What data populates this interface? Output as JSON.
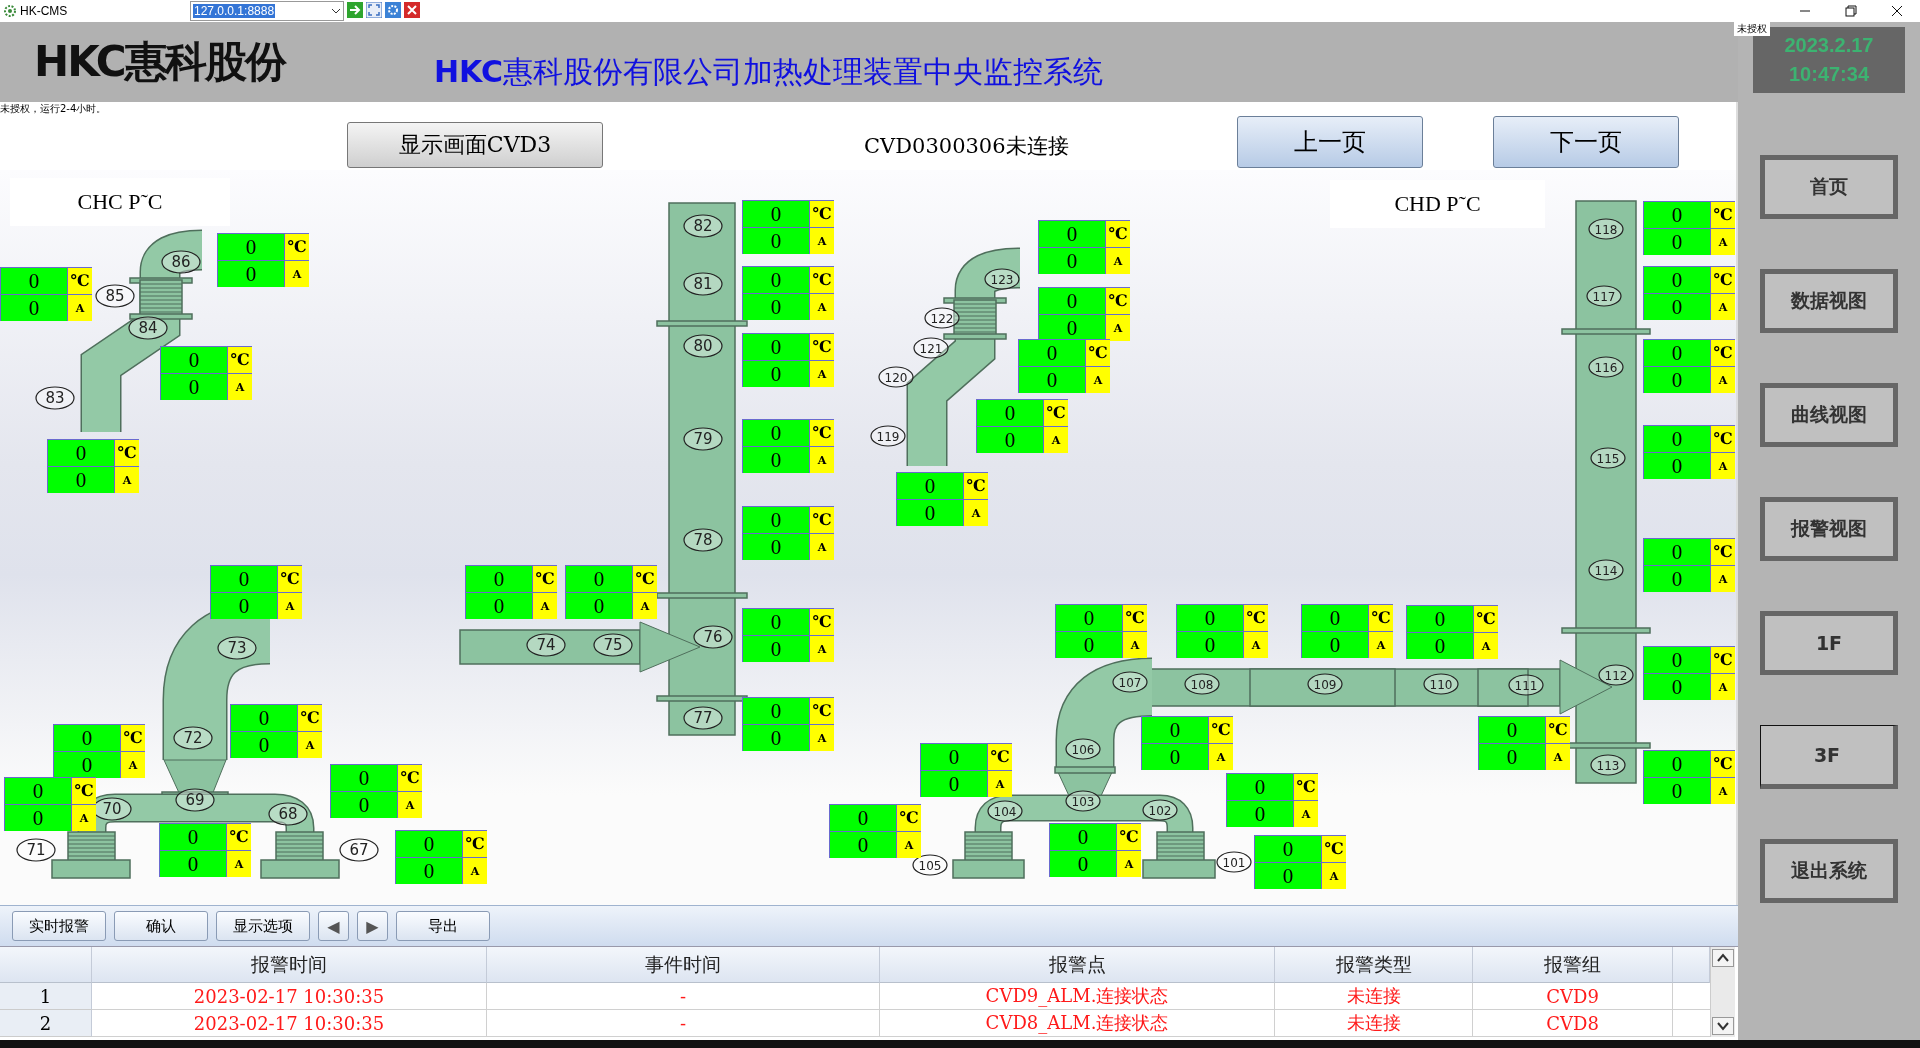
{
  "titlebar": {
    "app_name": "HK-CMS",
    "address": "127.0.0.1:8888"
  },
  "header": {
    "logo": "HKC惠科股份",
    "title": "**HKC**惠科股份有限公司加热处理装置中央监控系统",
    "overlay_notice": "未授权",
    "date": "2023.2.17",
    "time": "10:47:34"
  },
  "license_notice": "未授权，运行2-4小时。",
  "toolbar": {
    "display_button": "显示画面CVD3",
    "status": "CVD0300306未连接",
    "prev_button": "上一页",
    "next_button": "下一页"
  },
  "diagrams": [
    {
      "title": "CHC  P˜C",
      "segments": [
        "86",
        "85",
        "84",
        "83",
        "82",
        "81",
        "80",
        "79",
        "78",
        "73",
        "74",
        "75",
        "76",
        "77",
        "72",
        "70",
        "69",
        "68",
        "71",
        "67"
      ],
      "readings": [
        {
          "temp": "0",
          "temp_unit": "℃",
          "current": "0",
          "current_unit": "A"
        },
        {
          "temp": "0",
          "temp_unit": "℃",
          "current": "0",
          "current_unit": "A"
        },
        {
          "temp": "0",
          "temp_unit": "℃",
          "current": "0",
          "current_unit": "A"
        },
        {
          "temp": "0",
          "temp_unit": "℃",
          "current": "0",
          "current_unit": "A"
        },
        {
          "temp": "0",
          "temp_unit": "℃",
          "current": "0",
          "current_unit": "A"
        },
        {
          "temp": "0",
          "temp_unit": "℃",
          "current": "0",
          "current_unit": "A"
        },
        {
          "temp": "0",
          "temp_unit": "℃",
          "current": "0",
          "current_unit": "A"
        },
        {
          "temp": "0",
          "temp_unit": "℃",
          "current": "0",
          "current_unit": "A"
        },
        {
          "temp": "0",
          "temp_unit": "℃",
          "current": "0",
          "current_unit": "A"
        },
        {
          "temp": "0",
          "temp_unit": "℃",
          "current": "0",
          "current_unit": "A"
        },
        {
          "temp": "0",
          "temp_unit": "℃",
          "current": "0",
          "current_unit": "A"
        },
        {
          "temp": "0",
          "temp_unit": "℃",
          "current": "0",
          "current_unit": "A"
        },
        {
          "temp": "0",
          "temp_unit": "℃",
          "current": "0",
          "current_unit": "A"
        },
        {
          "temp": "0",
          "temp_unit": "℃",
          "current": "0",
          "current_unit": "A"
        },
        {
          "temp": "0",
          "temp_unit": "℃",
          "current": "0",
          "current_unit": "A"
        },
        {
          "temp": "0",
          "temp_unit": "℃",
          "current": "0",
          "current_unit": "A"
        },
        {
          "temp": "0",
          "temp_unit": "℃",
          "current": "0",
          "current_unit": "A"
        },
        {
          "temp": "0",
          "temp_unit": "℃",
          "current": "0",
          "current_unit": "A"
        },
        {
          "temp": "0",
          "temp_unit": "℃",
          "current": "0",
          "current_unit": "A"
        },
        {
          "temp": "0",
          "temp_unit": "℃",
          "current": "0",
          "current_unit": "A"
        }
      ]
    },
    {
      "title": "CHD  P˜C",
      "segments": [
        "123",
        "122",
        "121",
        "120",
        "119",
        "118",
        "117",
        "116",
        "115",
        "114",
        "112",
        "113",
        "107",
        "108",
        "109",
        "110",
        "111",
        "106",
        "104",
        "103",
        "102",
        "105",
        "101"
      ],
      "readings": [
        {
          "temp": "0",
          "temp_unit": "℃",
          "current": "0",
          "current_unit": "A"
        },
        {
          "temp": "0",
          "temp_unit": "℃",
          "current": "0",
          "current_unit": "A"
        },
        {
          "temp": "0",
          "temp_unit": "℃",
          "current": "0",
          "current_unit": "A"
        },
        {
          "temp": "0",
          "temp_unit": "℃",
          "current": "0",
          "current_unit": "A"
        },
        {
          "temp": "0",
          "temp_unit": "℃",
          "current": "0",
          "current_unit": "A"
        },
        {
          "temp": "0",
          "temp_unit": "℃",
          "current": "0",
          "current_unit": "A"
        },
        {
          "temp": "0",
          "temp_unit": "℃",
          "current": "0",
          "current_unit": "A"
        },
        {
          "temp": "0",
          "temp_unit": "℃",
          "current": "0",
          "current_unit": "A"
        },
        {
          "temp": "0",
          "temp_unit": "℃",
          "current": "0",
          "current_unit": "A"
        },
        {
          "temp": "0",
          "temp_unit": "℃",
          "current": "0",
          "current_unit": "A"
        },
        {
          "temp": "0",
          "temp_unit": "℃",
          "current": "0",
          "current_unit": "A"
        },
        {
          "temp": "0",
          "temp_unit": "℃",
          "current": "0",
          "current_unit": "A"
        },
        {
          "temp": "0",
          "temp_unit": "℃",
          "current": "0",
          "current_unit": "A"
        },
        {
          "temp": "0",
          "temp_unit": "℃",
          "current": "0",
          "current_unit": "A"
        },
        {
          "temp": "0",
          "temp_unit": "℃",
          "current": "0",
          "current_unit": "A"
        },
        {
          "temp": "0",
          "temp_unit": "℃",
          "current": "0",
          "current_unit": "A"
        },
        {
          "temp": "0",
          "temp_unit": "℃",
          "current": "0",
          "current_unit": "A"
        },
        {
          "temp": "0",
          "temp_unit": "℃",
          "current": "0",
          "current_unit": "A"
        },
        {
          "temp": "0",
          "temp_unit": "℃",
          "current": "0",
          "current_unit": "A"
        },
        {
          "temp": "0",
          "temp_unit": "℃",
          "current": "0",
          "current_unit": "A"
        },
        {
          "temp": "0",
          "temp_unit": "℃",
          "current": "0",
          "current_unit": "A"
        },
        {
          "temp": "0",
          "temp_unit": "℃",
          "current": "0",
          "current_unit": "A"
        },
        {
          "temp": "0",
          "temp_unit": "℃",
          "current": "0",
          "current_unit": "A"
        }
      ]
    }
  ],
  "alarm_toolbar": [
    {
      "label": "实时报警",
      "kind": "text"
    },
    {
      "label": "确认",
      "kind": "text"
    },
    {
      "label": "显示选项",
      "kind": "text"
    },
    {
      "label": "◀",
      "kind": "arrow"
    },
    {
      "label": "▶",
      "kind": "arrow"
    },
    {
      "label": "导出",
      "kind": "text"
    }
  ],
  "alarm_table": {
    "columns": [
      "报警时间",
      "事件时间",
      "报警点",
      "报警类型",
      "报警组"
    ],
    "rows": [
      {
        "index": "1",
        "cells": [
          "2023-02-17 10:30:35",
          "-",
          "CVD9_ALM.连接状态",
          "未连接",
          "CVD9"
        ]
      },
      {
        "index": "2",
        "cells": [
          "2023-02-17 10:30:35",
          "-",
          "CVD8_ALM.连接状态",
          "未连接",
          "CVD8"
        ]
      }
    ]
  },
  "sidebar": [
    {
      "label": "首页",
      "selected": false
    },
    {
      "label": "数据视图",
      "selected": false
    },
    {
      "label": "曲线视图",
      "selected": false
    },
    {
      "label": "报警视图",
      "selected": false
    },
    {
      "label": "1F",
      "selected": false
    },
    {
      "label": "3F",
      "selected": true
    },
    {
      "label": "退出系统",
      "selected": false
    }
  ]
}
